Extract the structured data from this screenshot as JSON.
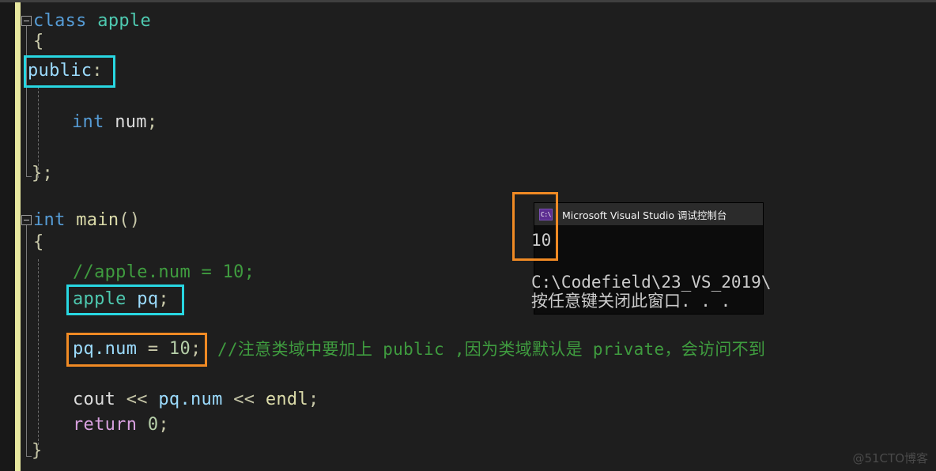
{
  "editor": {
    "background": "#1e1e1e",
    "change_bar_color": "#e8e8a0",
    "lines": [
      {
        "id": "l1",
        "text": "class apple"
      },
      {
        "id": "l2",
        "text": "{"
      },
      {
        "id": "l3",
        "text": "public:"
      },
      {
        "id": "l4",
        "text": "int num;"
      },
      {
        "id": "l5",
        "text": "};"
      },
      {
        "id": "l6",
        "text": "int main()"
      },
      {
        "id": "l7",
        "text": "{"
      },
      {
        "id": "l8",
        "text": "//apple.num = 10;"
      },
      {
        "id": "l9",
        "text": "apple pq;"
      },
      {
        "id": "l10",
        "text": "pq.num = 10;"
      },
      {
        "id": "l11",
        "text": "//注意类域中要加上 public ,因为类域默认是 private，会访问不到"
      },
      {
        "id": "l12",
        "text": "cout << pq.num << endl;"
      },
      {
        "id": "l13",
        "text": "return 0;"
      },
      {
        "id": "l14",
        "text": "}"
      }
    ],
    "tokens": {
      "kw_class": "class",
      "type_apple": "apple",
      "brace_open": "{",
      "kw_public": "public",
      "colon": ":",
      "kw_int": "int",
      "id_num": "num",
      "semi": ";",
      "brace_close_semi": "};",
      "func_main": "main",
      "parens": "()",
      "comment_apple_num": "//apple.num = 10;",
      "var_pq": "pq",
      "expr_pqnum": "pq.num",
      "eq": "=",
      "lit_10": "10",
      "comment_note": "//注意类域中要加上 public ,因为类域默认是 private，会访问不到",
      "id_cout": "cout",
      "shift": "<<",
      "id_endl": "endl",
      "kw_return": "return",
      "lit_0": "0",
      "brace_close": "}"
    }
  },
  "annotations": {
    "cyan_color": "#28d7e2",
    "orange_color": "#f08a24",
    "boxes": [
      {
        "name": "public-highlight",
        "color": "cyan",
        "target": "public:"
      },
      {
        "name": "apple-pq-highlight",
        "color": "cyan",
        "target": "apple pq;"
      },
      {
        "name": "pq-num-highlight",
        "color": "orange",
        "target": "pq.num = 10;"
      },
      {
        "name": "console-output-highlight",
        "color": "orange",
        "target": "10"
      }
    ]
  },
  "console": {
    "icon_label": "C:\\",
    "icon_name": "console-app-icon",
    "title": "Microsoft Visual Studio 调试控制台",
    "output_value": "10",
    "path_line": "C:\\Codefield\\23_VS_2019\\",
    "prompt_line": "按任意键关闭此窗口. . ."
  },
  "watermark": {
    "text": "@51CTO博客"
  }
}
